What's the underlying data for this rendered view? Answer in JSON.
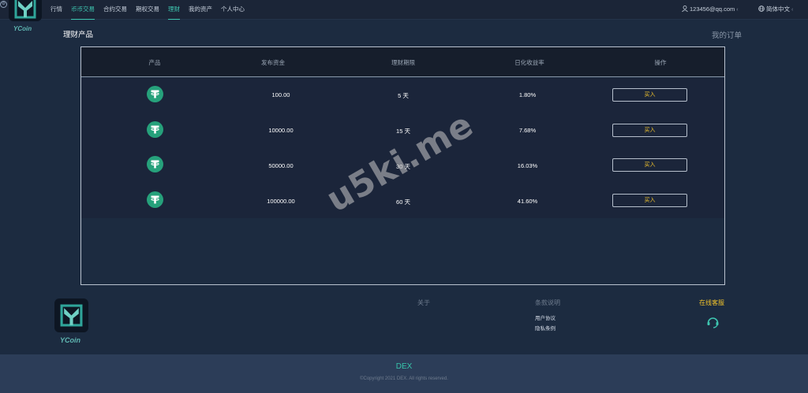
{
  "brand": "YCoin",
  "nav": {
    "items": [
      "行情",
      "币币交易",
      "合约交易",
      "期权交易",
      "理财",
      "我的资产",
      "个人中心"
    ],
    "active_index": 1,
    "active_index_2": 4,
    "user": "123456@qq.com",
    "language": "简体中文"
  },
  "page": {
    "title": "理财产品",
    "my_orders": "我的订单"
  },
  "table": {
    "headers": [
      "产品",
      "发布资金",
      "理财期限",
      "日化收益率",
      "操作"
    ],
    "rows": [
      {
        "coin_icon": "tether-icon",
        "amount": "100.00",
        "term": "5 天",
        "rate": "1.80%",
        "action": "买入"
      },
      {
        "coin_icon": "tether-icon",
        "amount": "10000.00",
        "term": "15 天",
        "rate": "7.68%",
        "action": "买入"
      },
      {
        "coin_icon": "tether-icon",
        "amount": "50000.00",
        "term": "30 天",
        "rate": "16.03%",
        "action": "买入"
      },
      {
        "coin_icon": "tether-icon",
        "amount": "100000.00",
        "term": "60 天",
        "rate": "41.60%",
        "action": "买入"
      }
    ]
  },
  "watermark": "u5ki.me",
  "footer": {
    "brand": "YCoin",
    "about": "关于",
    "terms_title": "条款说明",
    "terms_links": [
      "用户协议",
      "隐私条例"
    ],
    "online_service": "在线客服",
    "site": "DEX",
    "copyright": "©Copyright 2021 DEX. All rights reserved."
  },
  "colors": {
    "accent": "#3ec7b1",
    "buy": "#f0c22b",
    "tether": "#26a17b",
    "background": "#1c2b40"
  }
}
